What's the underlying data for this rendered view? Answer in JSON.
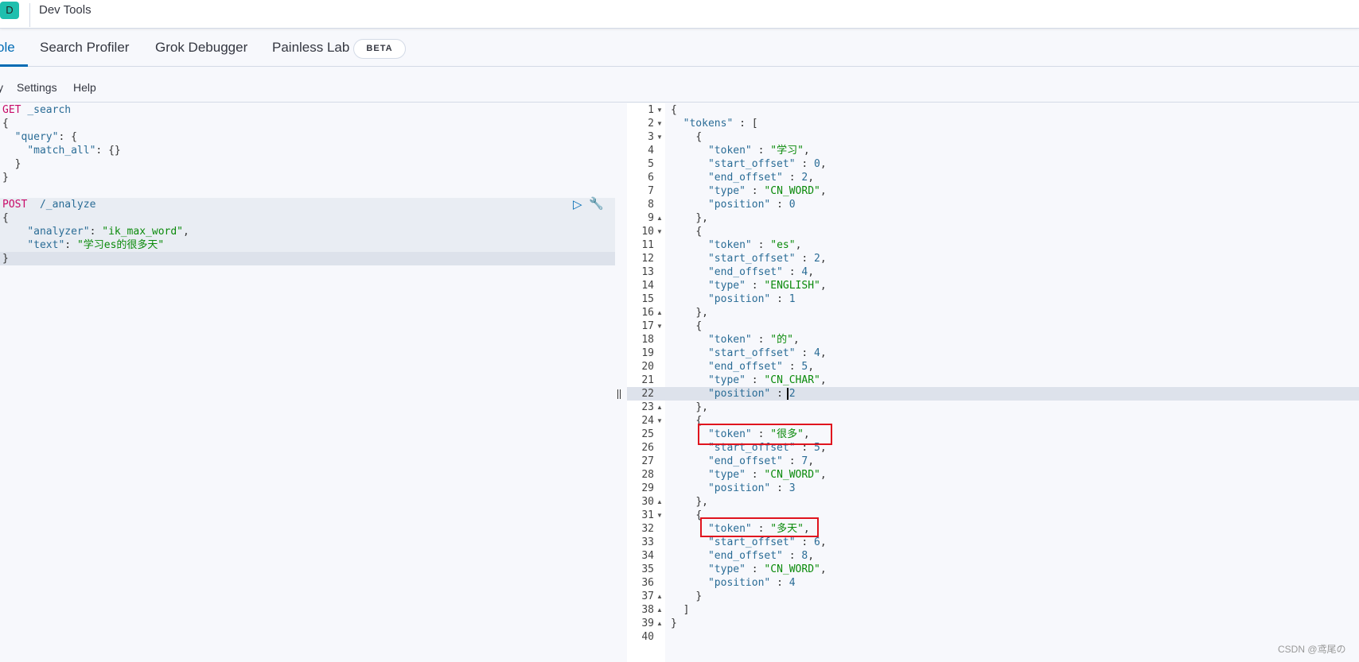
{
  "header": {
    "logo_letter": "D",
    "title": "Dev Tools"
  },
  "tabs": [
    {
      "label": "ole",
      "active": true
    },
    {
      "label": "Search Profiler"
    },
    {
      "label": "Grok Debugger"
    },
    {
      "label": "Painless Lab",
      "badge": "BETA"
    }
  ],
  "toolbar": {
    "items": [
      "y",
      "Settings",
      "Help"
    ]
  },
  "colors": {
    "accent": "#006bb4",
    "method": "#c80a68",
    "string": "#0a8a0a",
    "key": "#2a6c96",
    "highlight_box": "#e0141e"
  },
  "request_editor": {
    "lines": [
      "GET _search",
      "{",
      "  \"query\": {",
      "    \"match_all\": {}",
      "  }",
      "}",
      "",
      "POST  /_analyze",
      "{",
      "    \"analyzer\": \"ik_max_word\",",
      "    \"text\": \"学习es的很多天\"",
      "}"
    ],
    "icons": [
      "play-icon",
      "wrench-icon"
    ]
  },
  "response_editor": {
    "lines": [
      "{",
      "  \"tokens\" : [",
      "    {",
      "      \"token\" : \"学习\",",
      "      \"start_offset\" : 0,",
      "      \"end_offset\" : 2,",
      "      \"type\" : \"CN_WORD\",",
      "      \"position\" : 0",
      "    },",
      "    {",
      "      \"token\" : \"es\",",
      "      \"start_offset\" : 2,",
      "      \"end_offset\" : 4,",
      "      \"type\" : \"ENGLISH\",",
      "      \"position\" : 1",
      "    },",
      "    {",
      "      \"token\" : \"的\",",
      "      \"start_offset\" : 4,",
      "      \"end_offset\" : 5,",
      "      \"type\" : \"CN_CHAR\",",
      "      \"position\" : 2",
      "    },",
      "    {",
      "      \"token\" : \"很多\",",
      "      \"start_offset\" : 5,",
      "      \"end_offset\" : 7,",
      "      \"type\" : \"CN_WORD\",",
      "      \"position\" : 3",
      "    },",
      "    {",
      "      \"token\" : \"多天\",",
      "      \"start_offset\" : 6,",
      "      \"end_offset\" : 8,",
      "      \"type\" : \"CN_WORD\",",
      "      \"position\" : 4",
      "    }",
      "  ]",
      "}",
      ""
    ],
    "fold_open": [
      1,
      2,
      3,
      10,
      17,
      24,
      31
    ],
    "fold_close": [
      9,
      16,
      23,
      30,
      37,
      38,
      39
    ],
    "highlighted_lines": [
      25,
      32
    ]
  },
  "watermark": "CSDN @鸢尾の"
}
